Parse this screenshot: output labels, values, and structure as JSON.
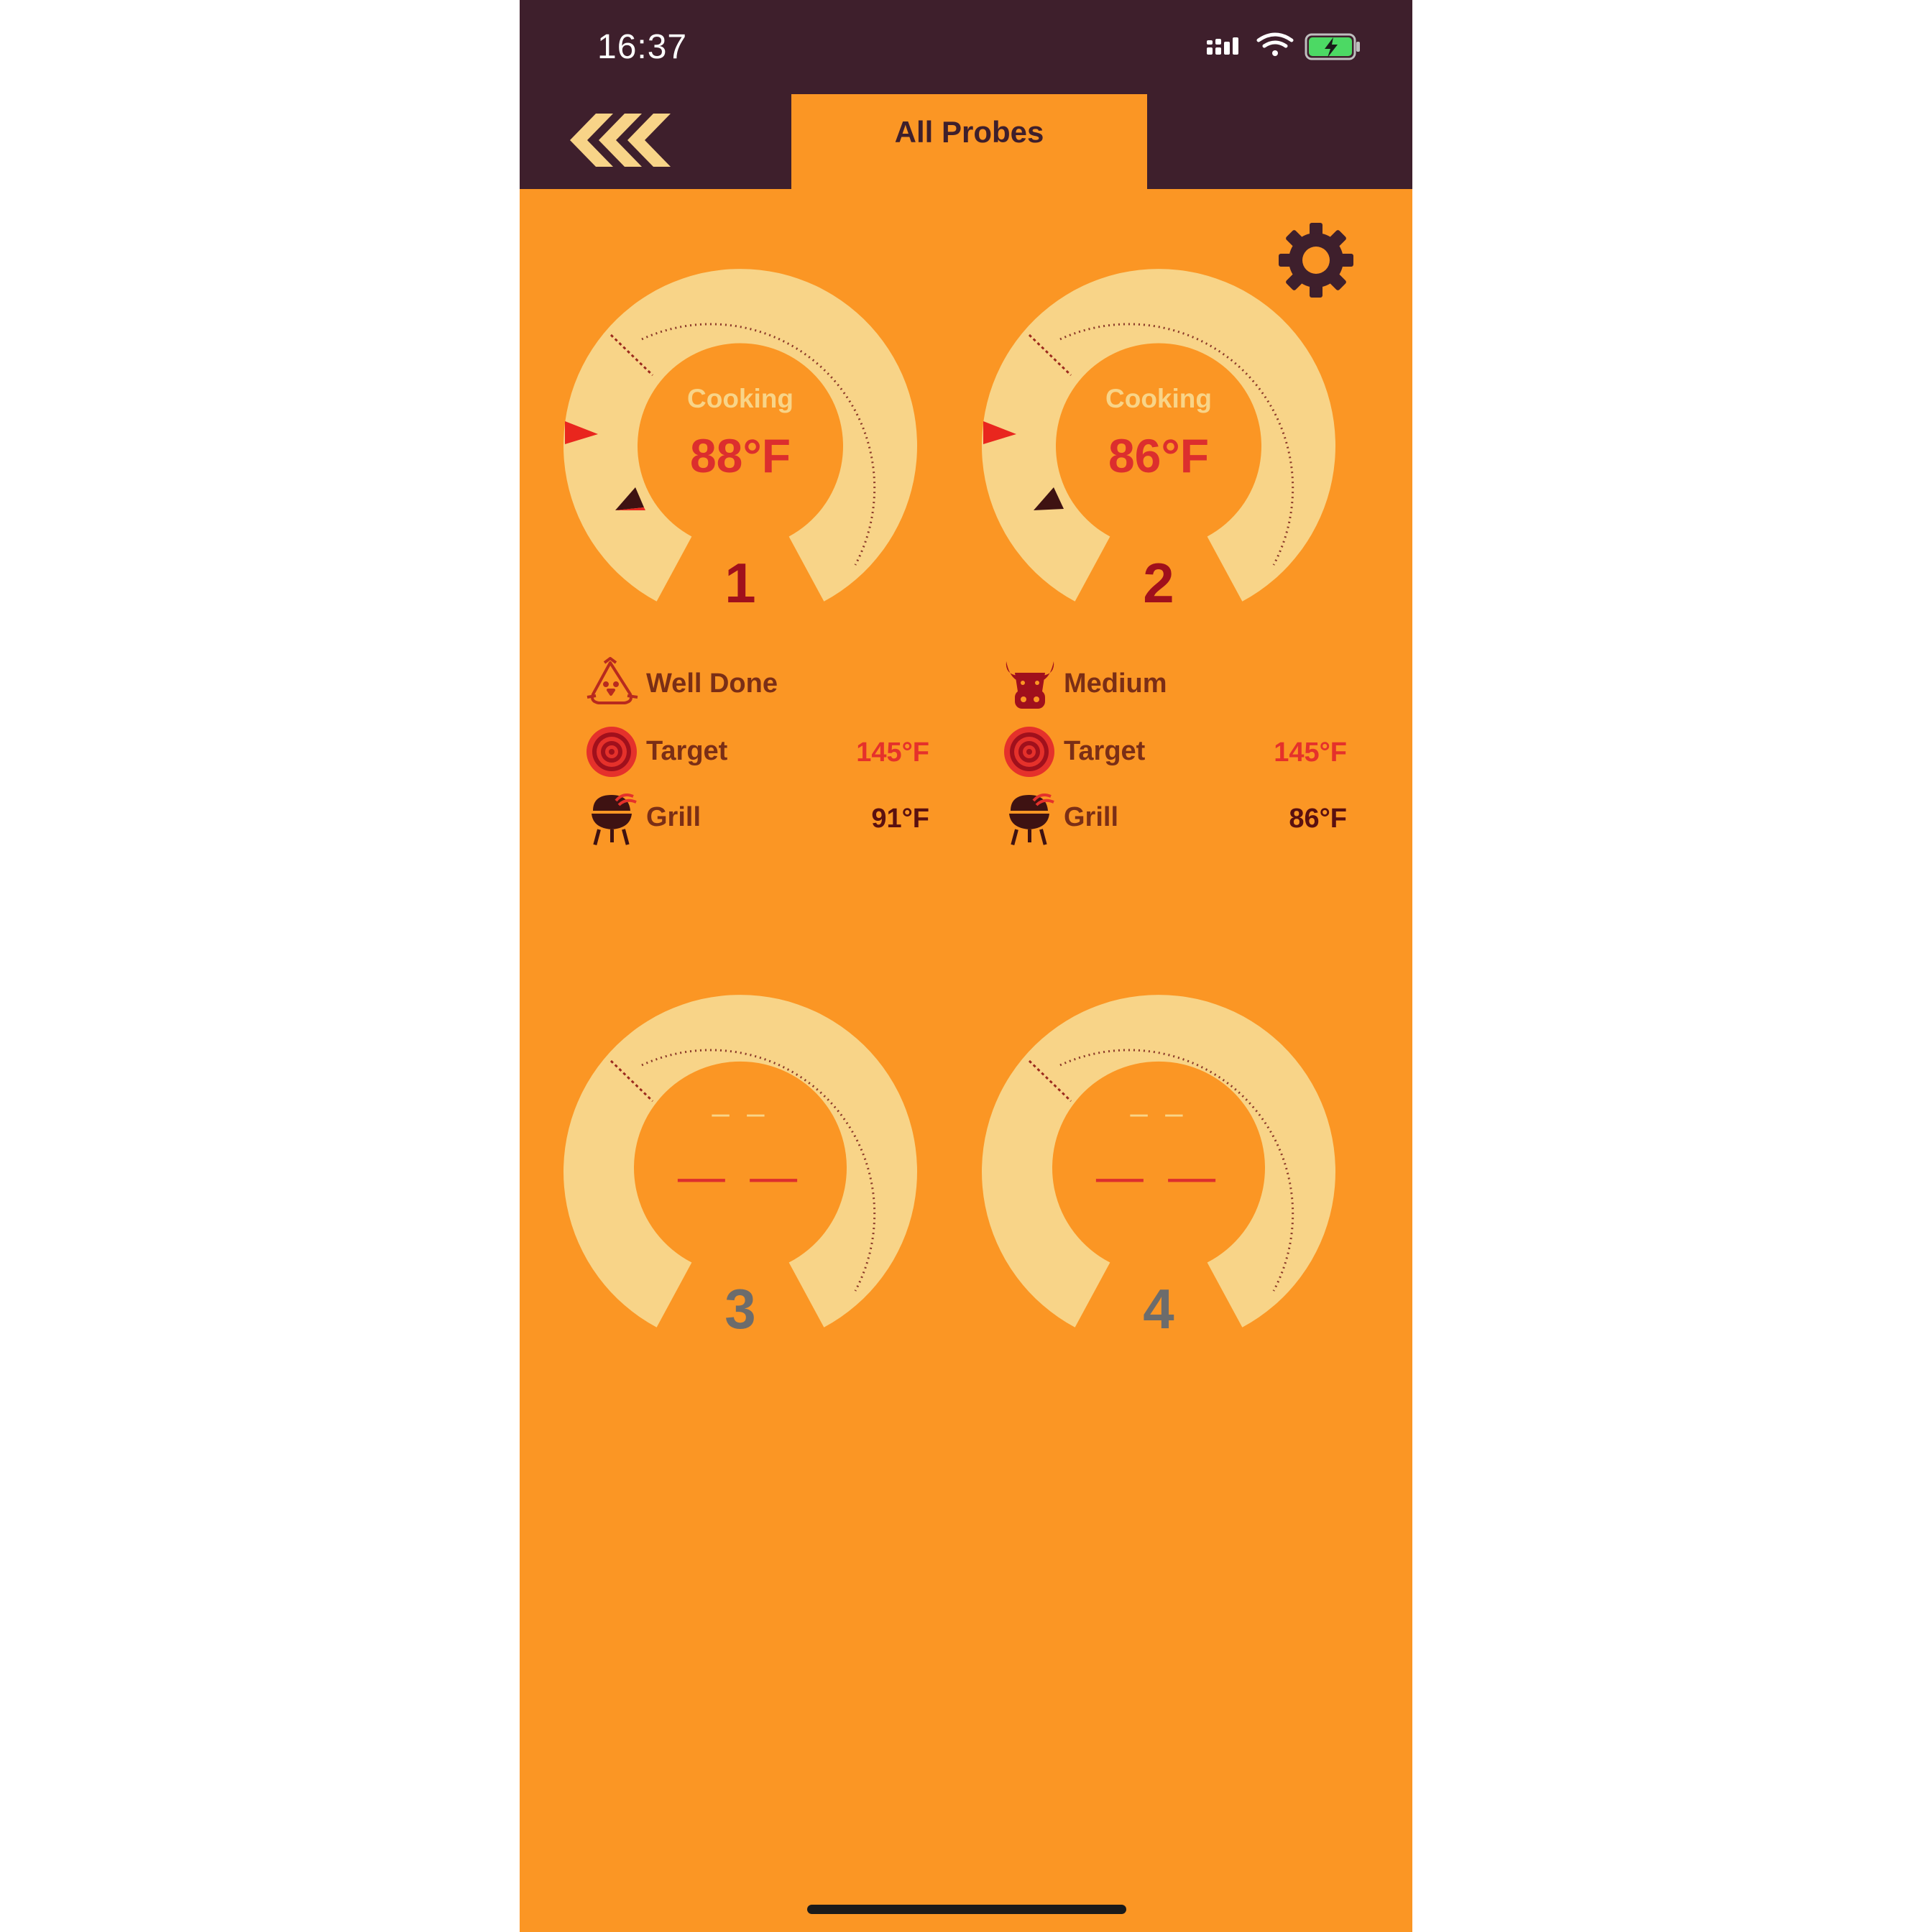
{
  "status_bar": {
    "time": "16:37"
  },
  "header": {
    "tab_label": "All Probes"
  },
  "probes": [
    {
      "number": "1",
      "status": "Cooking",
      "temp": "88°F",
      "doneness": "Well Done",
      "target_label": "Target",
      "target_value": "145°F",
      "grill_label": "Grill",
      "grill_value": "91°F"
    },
    {
      "number": "2",
      "status": "Cooking",
      "temp": "86°F",
      "doneness": "Medium",
      "target_label": "Target",
      "target_value": "145°F",
      "grill_label": "Grill",
      "grill_value": "86°F"
    },
    {
      "number": "3",
      "status_placeholder": "– –",
      "temp_placeholder": "— —"
    },
    {
      "number": "4",
      "status_placeholder": "– –",
      "temp_placeholder": "— —"
    }
  ],
  "colors": {
    "background": "#fb9624",
    "topbar": "#3e1f2c",
    "gauge_track": "#f8d488",
    "temperature": "#dc2e2e",
    "probe_number_active": "#a0101c",
    "probe_number_inactive": "#6c6c6c",
    "info_text": "#7a2e16",
    "target_value": "#e5312b",
    "grill_value": "#5a1010"
  },
  "icons": [
    "back-chevrons-icon",
    "settings-gear-icon",
    "chicken-icon",
    "cow-icon",
    "target-icon",
    "grill-icon",
    "signal-icon",
    "wifi-icon",
    "battery-charging-icon"
  ]
}
